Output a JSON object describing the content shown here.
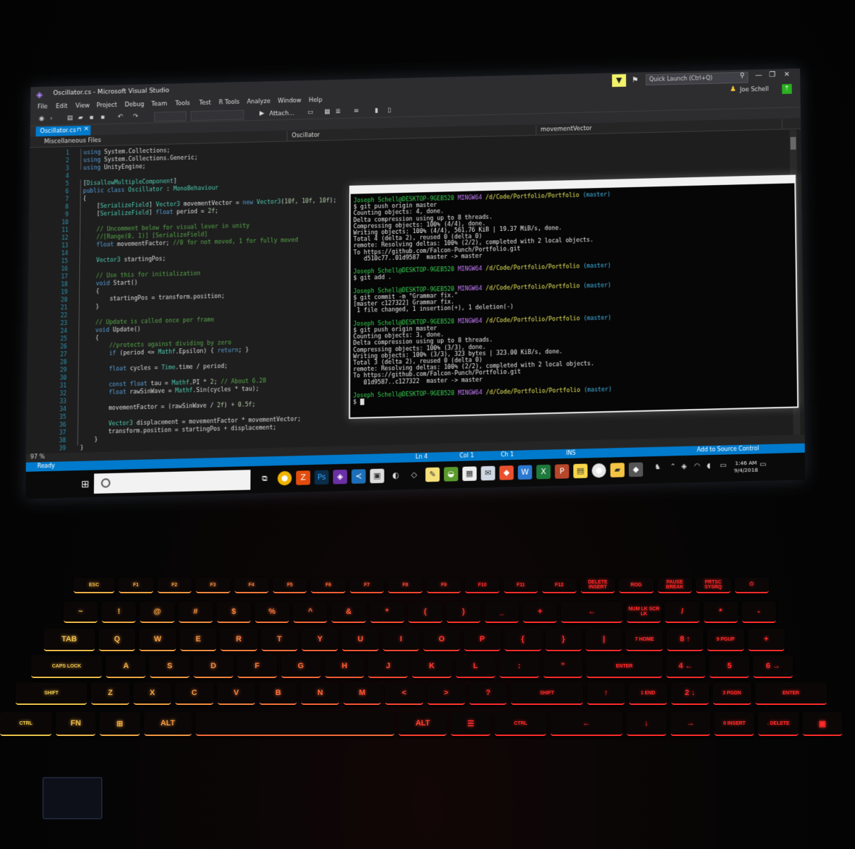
{
  "window": {
    "title": "Oscillator.cs - Microsoft Visual Studio",
    "quick_launch_placeholder": "Quick Launch (Ctrl+Q)",
    "user": "Joe Schell",
    "accent": "#007acc"
  },
  "menu": [
    "File",
    "Edit",
    "View",
    "Project",
    "Debug",
    "Team",
    "Tools",
    "Test",
    "R Tools",
    "Analyze",
    "Window",
    "Help"
  ],
  "toolbar": {
    "attach_label": "Attach..."
  },
  "tab": {
    "label": "Oscillator.cs"
  },
  "nav": {
    "project": "Miscellaneous Files",
    "class": "Oscillator",
    "member": "movementVector"
  },
  "editor": {
    "lines": [
      {
        "n": "1",
        "t": "using System.Collections;"
      },
      {
        "n": "2",
        "t": "using System.Collections.Generic;"
      },
      {
        "n": "3",
        "t": "using UnityEngine;"
      },
      {
        "n": "4",
        "t": ""
      },
      {
        "n": "5",
        "t": "[DisallowMultipleComponent]"
      },
      {
        "n": "6",
        "t": "public class Oscillator : MonoBehaviour"
      },
      {
        "n": "7",
        "t": "{"
      },
      {
        "n": "8",
        "t": "    [SerializeField] Vector3 movementVector = new Vector3(10f, 10f, 10f);"
      },
      {
        "n": "9",
        "t": "    [SerializeField] float period = 2f;"
      },
      {
        "n": "10",
        "t": ""
      },
      {
        "n": "11",
        "t": "    // Uncomment below for visual lever in unity"
      },
      {
        "n": "12",
        "t": "    //[Range(0, 1)] [SerializeField]"
      },
      {
        "n": "13",
        "t": "    float movementFactor; //0 for not moved, 1 for fully moved"
      },
      {
        "n": "14",
        "t": ""
      },
      {
        "n": "15",
        "t": "    Vector3 startingPos;"
      },
      {
        "n": "16",
        "t": ""
      },
      {
        "n": "17",
        "t": "    // Use this for initialization"
      },
      {
        "n": "18",
        "t": "    void Start()"
      },
      {
        "n": "19",
        "t": "    {"
      },
      {
        "n": "20",
        "t": "        startingPos = transform.position;"
      },
      {
        "n": "21",
        "t": "    }"
      },
      {
        "n": "22",
        "t": ""
      },
      {
        "n": "23",
        "t": "    // Update is called once per frame"
      },
      {
        "n": "24",
        "t": "    void Update()"
      },
      {
        "n": "25",
        "t": "    {"
      },
      {
        "n": "26",
        "t": "        //protects against dividing by zero"
      },
      {
        "n": "27",
        "t": "        if (period <= Mathf.Epsilon) { return; }"
      },
      {
        "n": "28",
        "t": ""
      },
      {
        "n": "29",
        "t": "        float cycles = Time.time / period;"
      },
      {
        "n": "30",
        "t": ""
      },
      {
        "n": "31",
        "t": "        const float tau = Mathf.PI * 2; // About 6.28"
      },
      {
        "n": "32",
        "t": "        float rawSinWave = Mathf.Sin(cycles * tau);"
      },
      {
        "n": "33",
        "t": ""
      },
      {
        "n": "34",
        "t": "        movementFactor = (rawSinWave / 2f) + 0.5f;"
      },
      {
        "n": "35",
        "t": ""
      },
      {
        "n": "36",
        "t": "        Vector3 displacement = movementFactor * movementVector;"
      },
      {
        "n": "37",
        "t": "        transform.position = startingPos + displacement;"
      },
      {
        "n": "38",
        "t": "    }"
      },
      {
        "n": "39",
        "t": "}"
      }
    ],
    "zoom": "97 %"
  },
  "status": {
    "ready": "Ready",
    "ln": "Ln 4",
    "col": "Col 1",
    "ch": "Ch 1",
    "ins": "INS",
    "source_control": "Add to Source Control"
  },
  "terminal": {
    "prompt_user": "Joseph Schell@DESKTOP-9GEB520",
    "prompt_shell": "MINGW64",
    "prompt_path": "/d/Code/Portfolio/Portfolio",
    "prompt_branch": "(master)",
    "lines": [
      {
        "kind": "prompt"
      },
      {
        "kind": "cmd",
        "t": "$ git push origin master"
      },
      {
        "kind": "out",
        "t": "Counting objects: 4, done."
      },
      {
        "kind": "out",
        "t": "Delta compression using up to 8 threads."
      },
      {
        "kind": "out",
        "t": "Compressing objects: 100% (4/4), done."
      },
      {
        "kind": "out",
        "t": "Writing objects: 100% (4/4), 561.76 KiB | 19.37 MiB/s, done."
      },
      {
        "kind": "out",
        "t": "Total 4 (delta 2), reused 0 (delta 0)"
      },
      {
        "kind": "out",
        "t": "remote: Resolving deltas: 100% (2/2), completed with 2 local objects."
      },
      {
        "kind": "out",
        "t": "To https://github.com/Falcon-Punch/Portfolio.git"
      },
      {
        "kind": "out",
        "t": "   d510c77..01d9587  master -> master"
      },
      {
        "kind": "blank"
      },
      {
        "kind": "prompt"
      },
      {
        "kind": "cmd",
        "t": "$ git add ."
      },
      {
        "kind": "blank"
      },
      {
        "kind": "prompt"
      },
      {
        "kind": "cmd",
        "t": "$ git commit -m \"Grammar fix.\""
      },
      {
        "kind": "out",
        "t": "[master c127322] Grammar fix."
      },
      {
        "kind": "out",
        "t": " 1 file changed, 1 insertion(+), 1 deletion(-)"
      },
      {
        "kind": "blank"
      },
      {
        "kind": "prompt"
      },
      {
        "kind": "cmd",
        "t": "$ git push origin master"
      },
      {
        "kind": "out",
        "t": "Counting objects: 3, done."
      },
      {
        "kind": "out",
        "t": "Delta compression using up to 8 threads."
      },
      {
        "kind": "out",
        "t": "Compressing objects: 100% (3/3), done."
      },
      {
        "kind": "out",
        "t": "Writing objects: 100% (3/3), 323 bytes | 323.00 KiB/s, done."
      },
      {
        "kind": "out",
        "t": "Total 3 (delta 2), reused 0 (delta 0)"
      },
      {
        "kind": "out",
        "t": "remote: Resolving deltas: 100% (2/2), completed with 2 local objects."
      },
      {
        "kind": "out",
        "t": "To https://github.com/Falcon-Punch/Portfolio.git"
      },
      {
        "kind": "out",
        "t": "   01d9587..c127322  master -> master"
      },
      {
        "kind": "blank"
      },
      {
        "kind": "prompt"
      },
      {
        "kind": "cmd",
        "t": "$ "
      }
    ]
  },
  "taskbar": {
    "time": "1:46 AM",
    "date": "9/4/2018"
  },
  "keyboard": {
    "rows": [
      [
        "ESC",
        "F1",
        "F2",
        "F3",
        "F4",
        "F5",
        "F6",
        "F7",
        "F8",
        "F9",
        "F10",
        "F11",
        "F12",
        "DELETE INSERT",
        "ROG",
        "PAUSE BREAK",
        "PRTSC SYSRQ",
        "⏻"
      ],
      [
        "~",
        "!",
        "@",
        "#",
        "$",
        "%",
        "^",
        "&",
        "*",
        "(",
        ")",
        "_",
        "+",
        "←",
        "NUM LK SCR LK",
        "/",
        "*",
        "-"
      ],
      [
        "TAB",
        "Q",
        "W",
        "E",
        "R",
        "T",
        "Y",
        "U",
        "I",
        "O",
        "P",
        "{",
        "}",
        "|",
        "7 HOME",
        "8 ↑",
        "9 PGUP",
        "+"
      ],
      [
        "CAPS LOCK",
        "A",
        "S",
        "D",
        "F",
        "G",
        "H",
        "J",
        "K",
        "L",
        ":",
        "\"",
        "ENTER",
        "4 ←",
        "5",
        "6 →"
      ],
      [
        "SHIFT",
        "Z",
        "X",
        "C",
        "V",
        "B",
        "N",
        "M",
        "<",
        ">",
        "?",
        "SHIFT",
        "↑",
        "1 END",
        "2 ↓",
        "3 PGDN",
        "ENTER"
      ],
      [
        "CTRL",
        "FN",
        "⊞",
        "ALT",
        "",
        "ALT",
        "☰",
        "CTRL",
        "←",
        "↓",
        "→",
        "0 INSERT",
        ". DELETE",
        "▣"
      ]
    ],
    "gradient_left": "#e8c34a",
    "gradient_right": "#ff2a2a"
  }
}
